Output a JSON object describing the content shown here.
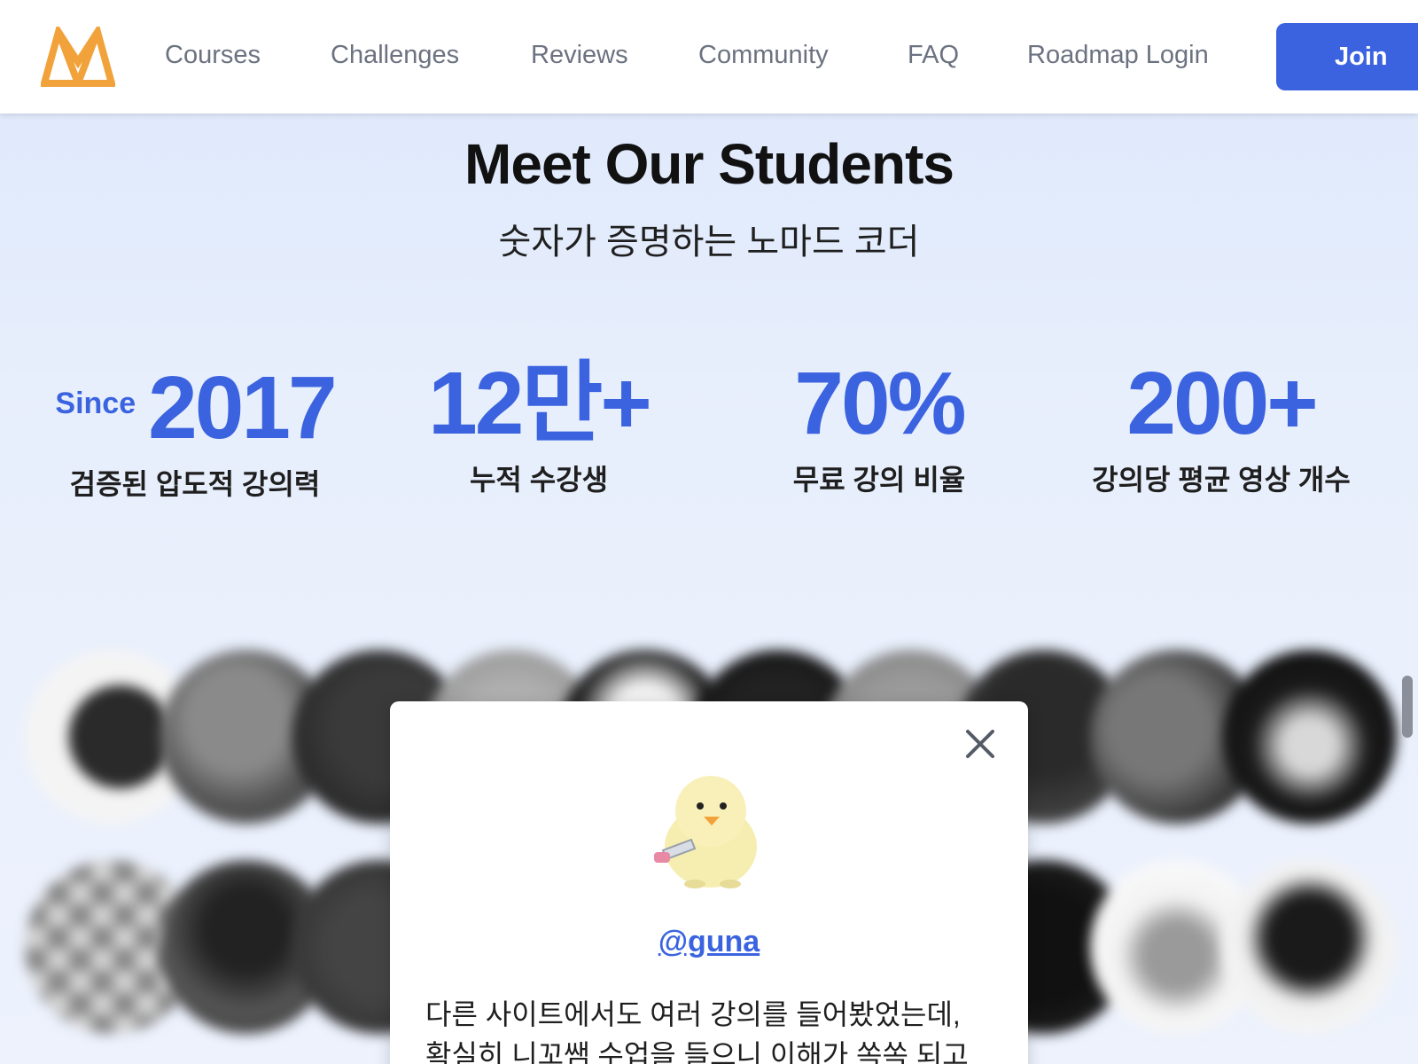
{
  "header": {
    "nav": [
      "Courses",
      "Challenges",
      "Reviews",
      "Community",
      "FAQ",
      "Roadmap Login"
    ],
    "join_label": "Join"
  },
  "hero": {
    "title": "Meet Our Students",
    "subtitle": "숫자가 증명하는 노마드 코더"
  },
  "stats": [
    {
      "prefix": "Since",
      "value": "2017",
      "label": "검증된 압도적 강의력"
    },
    {
      "prefix": "",
      "value": "12만+",
      "label": "누적 수강생"
    },
    {
      "prefix": "",
      "value": "70%",
      "label": "무료 강의 비율"
    },
    {
      "prefix": "",
      "value": "200+",
      "label": "강의당 평균 영상 개수"
    }
  ],
  "modal": {
    "username": "@guna",
    "review_line1": "다른 사이트에서도 여러 강의를 들어봤었는데,",
    "review_line2": "확실히 니꼬쌤 수업을 들으니 이해가 쏙쏙 되고"
  },
  "colors": {
    "accent": "#3b63e0",
    "logo": "#f2a23b"
  },
  "icons": {
    "close": "close-icon",
    "logo": "nomad-logo-icon"
  }
}
